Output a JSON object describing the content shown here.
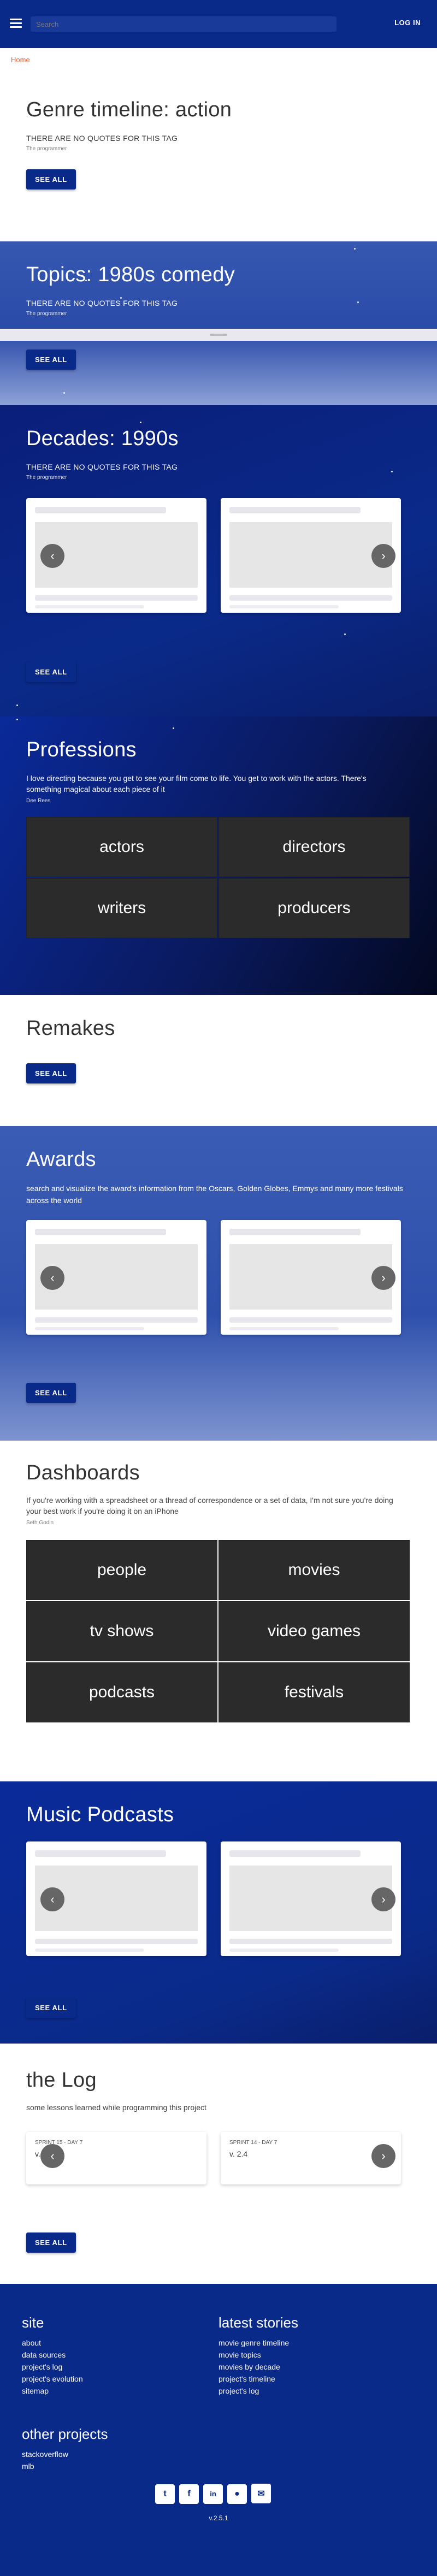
{
  "topbar": {
    "search_placeholder": "Search",
    "login_label": "LOG IN"
  },
  "breadcrumb": "Home",
  "genre": {
    "title": "Genre timeline: action",
    "quote": "THERE ARE NO QUOTES FOR THIS TAG",
    "author": "The programmer",
    "button": "SEE ALL"
  },
  "topics": {
    "title": "Topics: 1980s comedy",
    "quote": "THERE ARE NO QUOTES FOR THIS TAG",
    "author": "The programmer",
    "button": "SEE ALL"
  },
  "decades": {
    "title": "Decades: 1990s",
    "quote": "THERE ARE NO QUOTES FOR THIS TAG",
    "author": "The programmer",
    "button": "SEE ALL"
  },
  "professions": {
    "title": "Professions",
    "quote": "I love directing because you get to see your film come to life. You get to work with the actors. There's something magical about each piece of it",
    "author": "Dee Rees",
    "tiles": [
      "actors",
      "directors",
      "writers",
      "producers"
    ]
  },
  "remakes": {
    "title": "Remakes",
    "button": "SEE ALL"
  },
  "awards": {
    "title": "Awards",
    "description": "search and visualize the award's information from the Oscars, Golden Globes, Emmys and many more festivals across the world",
    "button": "SEE ALL"
  },
  "dashboards": {
    "title": "Dashboards",
    "quote": "If you're working with a spreadsheet or a thread of correspondence or a set of data, I'm not sure you're doing your best work if you're doing it on an iPhone",
    "author": "Seth Godin",
    "tiles": [
      "people",
      "movies",
      "tv shows",
      "video games",
      "podcasts",
      "festivals"
    ]
  },
  "music": {
    "title": "Music Podcasts",
    "button": "SEE ALL"
  },
  "log": {
    "title": "the Log",
    "description": "some lessons learned while programming this project",
    "cards": [
      {
        "sprint": "SPRINT 15 - DAY 7",
        "version": "v. 2.5"
      },
      {
        "sprint": "SPRINT 14 - DAY 7",
        "version": "v. 2.4"
      }
    ],
    "button": "SEE ALL"
  },
  "footer": {
    "site_title": "site",
    "site_links": [
      "about",
      "data sources",
      "project's log",
      "project's evolution",
      "sitemap"
    ],
    "stories_title": "latest stories",
    "stories_links": [
      "movie genre timeline",
      "movie topics",
      "movies by decade",
      "project's timeline",
      "project's log"
    ],
    "other_title": "other projects",
    "other_links": [
      "stackoverflow",
      "mlb"
    ],
    "social_icons": [
      "twitter-icon",
      "facebook-icon",
      "linkedin-icon",
      "github-icon",
      "email-icon"
    ],
    "version": "v.2.5.1"
  },
  "colors": {
    "navy": "#0a2a8a",
    "accent": "#ff5722",
    "gray_button": "#666666"
  }
}
